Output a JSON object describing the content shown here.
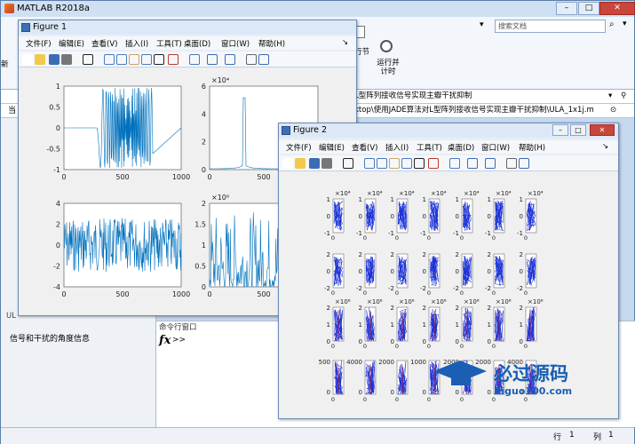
{
  "main_window": {
    "title": "MATLAB R2018a",
    "search_placeholder": "搜索文档",
    "ribbon": {
      "run_section_label": "运行并\n计时",
      "partial_label": "行节"
    },
    "path_bar": "L型阵列接收信号实现主瓣干扰抑制",
    "address_bar": "ktop\\使用JADE算法对L型阵列接收信号实现主瓣干扰抑制\\ULA_1x1j.m",
    "left_truncated": "当",
    "workspace_label": "UL",
    "info_label": "信号和干扰的角度信息",
    "command_window_title": "命令行窗口",
    "fx_symbol": "fx",
    "prompt": ">>",
    "status": {
      "row_label": "行",
      "row_value": "1",
      "col_label": "列",
      "col_value": "1"
    }
  },
  "figure1": {
    "title": "Figure 1",
    "menus": [
      "文件(F)",
      "编辑(E)",
      "查看(V)",
      "插入(I)",
      "工具(T)",
      "桌面(D)",
      "窗口(W)",
      "帮助(H)"
    ],
    "plots": [
      {
        "yticks": [
          "1",
          "0.5",
          "0",
          "-0.5",
          "-1"
        ],
        "xticks": [
          "0",
          "500",
          "1000"
        ]
      },
      {
        "exp": "×10⁴",
        "yticks": [
          "6",
          "4",
          "2",
          "0"
        ],
        "xticks": [
          "0",
          "500"
        ]
      },
      {
        "yticks": [
          "4",
          "2",
          "0",
          "-2",
          "-4"
        ],
        "xticks": [
          "0",
          "500",
          "1000"
        ]
      },
      {
        "exp": "×10⁶",
        "yticks": [
          "2",
          "1.5",
          "1",
          "0.5",
          "0"
        ],
        "xticks": [
          "0",
          "500"
        ]
      }
    ]
  },
  "figure2": {
    "title": "Figure 2",
    "menus": [
      "文件(F)",
      "编辑(E)",
      "查看(V)",
      "插入(I)",
      "工具(T)",
      "桌面(D)",
      "窗口(W)",
      "帮助(H)"
    ],
    "rows": [
      {
        "exp": "×10⁴",
        "yticks": [
          "1",
          "0",
          "-1"
        ],
        "xticks": [
          "0",
          "0"
        ]
      },
      {
        "exp": "",
        "yticks": [
          "2",
          "0",
          "-2"
        ],
        "xticks": [
          "0",
          "0"
        ]
      },
      {
        "exp": "×10⁶",
        "yticks": [
          "2",
          "1",
          "0"
        ],
        "xticks": [
          "0",
          "0"
        ]
      },
      {
        "exp": "",
        "yticks": [
          "400",
          "200",
          "0"
        ],
        "xticks": [
          "0",
          "0"
        ]
      }
    ],
    "row4_top_ticks": [
      "500",
      "4000",
      "2000",
      "1000",
      "2000",
      "2000",
      "4000"
    ]
  },
  "watermark": {
    "title": "必过源码",
    "subtitle": "Biguo100.com"
  },
  "colors": {
    "plot_line": "#0072bd",
    "plot_line_dark": "#1a2fd6",
    "red_mark": "#e02020",
    "window_frame": "#6d8cb5"
  }
}
